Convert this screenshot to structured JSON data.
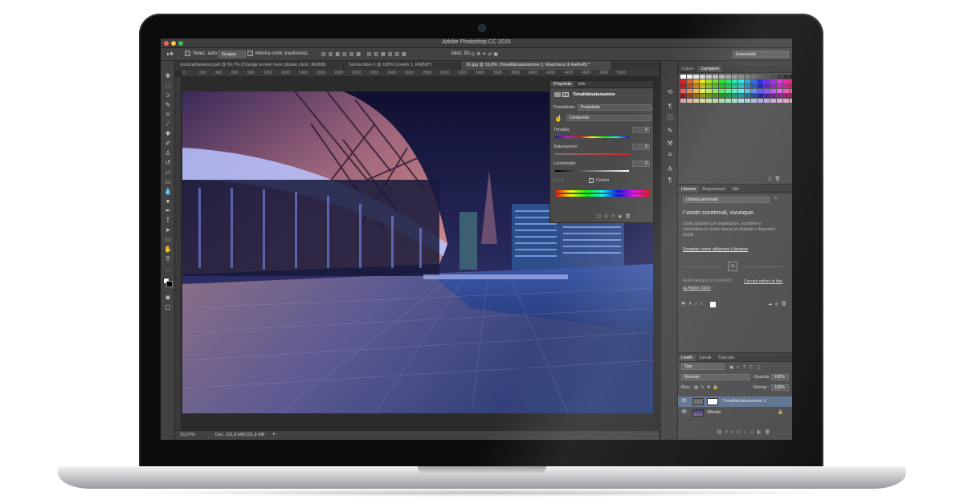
{
  "app": {
    "title": "Adobe Photoshop CC 2015"
  },
  "options_bar": {
    "auto_select_label": "Selez. auto:",
    "auto_select_value": "Gruppo",
    "show_transform_label": "Mostra contr. trasformaz.",
    "mode_3d_label": "Mod. 3D:",
    "workspace": "Essenziali"
  },
  "tabs": [
    {
      "label": "mockupNetword.psd @ 66,7% (Change screen here (doube click), RGB/8)"
    },
    {
      "label": "Senza titolo-1 @ 100% (Livello 1, RGB/8*)"
    },
    {
      "label": "16.jpg @ 16,6% (Tonalità/saturazione 1, Maschera di livello/8) *"
    }
  ],
  "ruler_ticks": [
    "0",
    "200",
    "400",
    "600",
    "800",
    "1000",
    "1200",
    "1400",
    "1600",
    "1800",
    "2000",
    "2200",
    "2400",
    "2600",
    "2800",
    "3000",
    "3200",
    "3400",
    "3600",
    "3800",
    "4000",
    "4200",
    "4400",
    "4600",
    "4800",
    "5000"
  ],
  "status_bar": {
    "zoom": "16,57%",
    "doc": "Doc: 101,8 MB/101,8 MB"
  },
  "properties_panel": {
    "tabs": [
      "Proprietà",
      "Info"
    ],
    "title": "Tonalità/saturazione",
    "preset_label": "Predefinito:",
    "preset_value": "Predefinito",
    "channel_value": "Composita",
    "hue_label": "Tonalità:",
    "hue_value": "0",
    "saturation_label": "Saturazione:",
    "saturation_value": "0",
    "lightness_label": "Luminosità:",
    "lightness_value": "0",
    "colorize_label": "Colora"
  },
  "swatches_panel": {
    "tabs": [
      "Colore",
      "Campioni"
    ]
  },
  "libraries_panel": {
    "tabs": [
      "Librerie",
      "Regolazioni",
      "Stili"
    ],
    "library_select": "Libreria personale",
    "heading": "I vostri contenuti, ovunque.",
    "body": "Usate Libraries per organizzare, accedere e condividere le vostre risorse su desktop e dispositivi mobili.",
    "link": "Scoprite come utilizzare Libraries",
    "stock_prompt": "Avete bisogno di contenuti?",
    "stock_link": "Cercate milioni di foto su Adobe Stock",
    "stock_icon": "St"
  },
  "layers_panel": {
    "tabs": [
      "Livelli",
      "Canali",
      "Tracciati"
    ],
    "filter_value": "Tipo",
    "blend_mode": "Normale",
    "opacity_label": "Opacità:",
    "opacity_value": "100%",
    "lock_label": "Bloc.:",
    "fill_label": "Riemp.:",
    "fill_value": "100%",
    "layers": [
      {
        "name": "Tonalità/saturazione 1"
      },
      {
        "name": "Sfondo"
      }
    ]
  },
  "colors": {
    "close": "#fc605c",
    "minimize": "#fdbc40",
    "zoom": "#34c84a",
    "selected_layer": "#5a6e8c"
  }
}
